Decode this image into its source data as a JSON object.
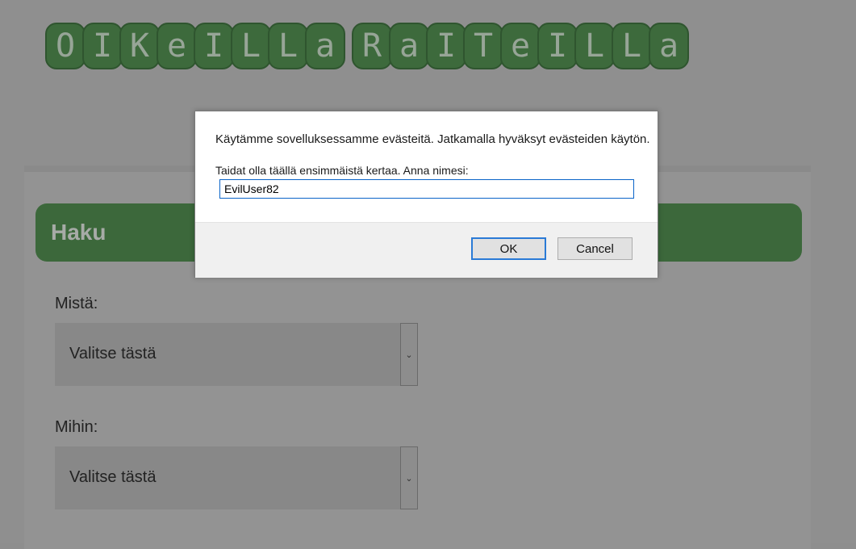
{
  "logo": {
    "words": [
      [
        "O",
        "I",
        "K",
        "e",
        "I",
        "L",
        "L",
        "a"
      ],
      [
        "R",
        "a",
        "I",
        "T",
        "e",
        "I",
        "L",
        "L",
        "a"
      ]
    ],
    "tile_color": "#3d6a3c"
  },
  "search": {
    "title": "Haku",
    "from_label": "Mistä:",
    "from_value": "Valitse tästä",
    "to_label": "Mihin:",
    "to_value": "Valitse tästä"
  },
  "dialog": {
    "message": "Käytämme sovelluksessamme evästeitä. Jatkamalla hyväksyt evästeiden käytön.",
    "prompt": "Taidat olla täällä ensimmäistä kertaa. Anna nimesi:",
    "input_value": "EvilUser82",
    "ok_label": "OK",
    "cancel_label": "Cancel",
    "focus_color": "#2a7ad6"
  },
  "colors": {
    "brand_green": "#3c683b",
    "overlay_gray": "#8f8f8f"
  }
}
